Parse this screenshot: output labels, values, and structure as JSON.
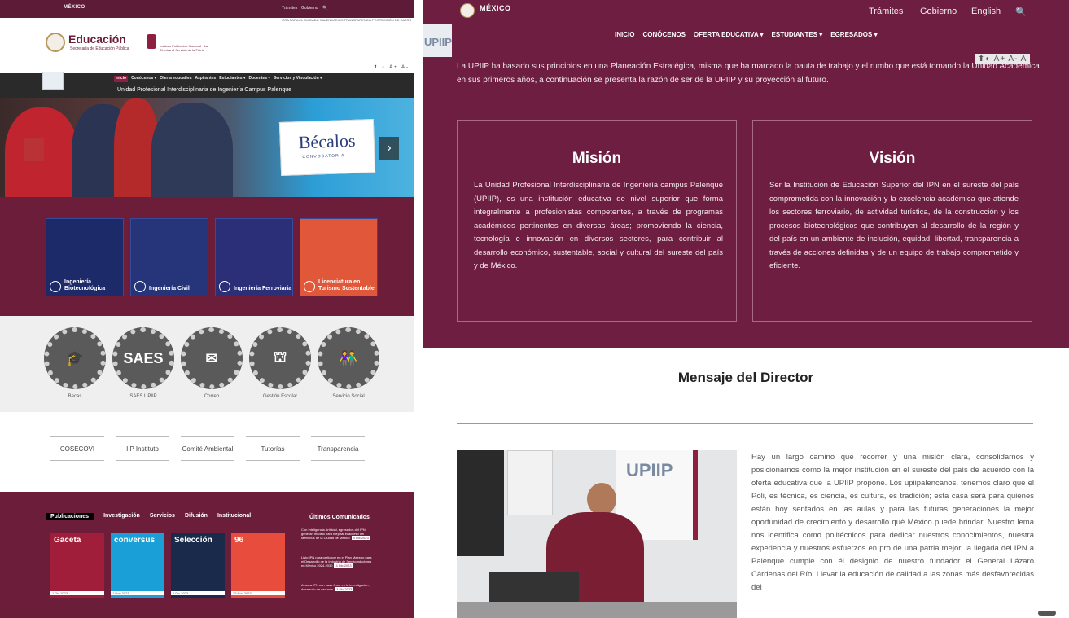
{
  "left": {
    "gov_logo": "MÉXICO",
    "gov_links": [
      "Trámites",
      "Gobierno",
      "🔍"
    ],
    "sub_links": "VIRA PARA EL CUIDADO  CALENDARIOS  TRANSPARENCIA  PROTECCIÓN DE DATOS",
    "edu_title": "Educación",
    "edu_sub": "Secretaría de Educación Pública",
    "ipn_text": "Instituto Politécnico Nacional · La Técnica al Servicio de la Patria",
    "access": "⬆ ◐ A+ A-",
    "nav": [
      "Inicio",
      "Conócenos ▾",
      "Oferta educativa",
      "Aspirantes",
      "Estudiantes ▾",
      "Docentes ▾",
      "Servicios y Vinculación ▾"
    ],
    "unit_name": "Unidad Profesional Interdisciplinaria de Ingeniería Campus Palenque",
    "becalos_title": "Bécalos",
    "becalos_sub": "CONVOCATORIA",
    "carousel_next": "›",
    "cards": [
      {
        "label": "Ingeniería Biotecnológica",
        "color": "#1c2a6a"
      },
      {
        "label": "Ingeniería Civil",
        "color": "#26357a"
      },
      {
        "label": "Ingeniería Ferroviaria",
        "color": "#2a2f78"
      },
      {
        "label": "Licenciatura en Turismo Sustentable",
        "color": "#e0573a"
      }
    ],
    "services": [
      {
        "glyph": "🎓",
        "label": "Becas"
      },
      {
        "glyph": "SAES",
        "label": "SAES UPIIP"
      },
      {
        "glyph": "✉",
        "label": "Correo"
      },
      {
        "glyph": "⛫",
        "label": "Gestión Escolar"
      },
      {
        "glyph": "👫",
        "label": "Servicio Social"
      }
    ],
    "logos": [
      "COSECOVI",
      "IIP Instituto",
      "Comité Ambiental",
      "Tutorías",
      "Transparencia"
    ],
    "tabs": [
      "Publicaciones",
      "Investigación",
      "Servicios",
      "Difusión",
      "Institucional"
    ],
    "comunicados_title": "Últimos Comunicados",
    "pubs": [
      {
        "title": "Gaceta",
        "date": "1 Dic 2023",
        "color": "#a01e3a"
      },
      {
        "title": "conversus",
        "date": "1 Nov 2023",
        "color": "#1a9fd6"
      },
      {
        "title": "Selección",
        "date": "1 Dic 2023",
        "color": "#1a2a4a"
      },
      {
        "title": "96",
        "date": "25 Nov 2023",
        "color": "#e74c3c"
      }
    ],
    "news": [
      {
        "text": "Con Inteligencia Artificial, egresados del IPN generan modelo para mejorar el acceso del Metrobús de la Ciudad de México",
        "date": "4 Dic 2023"
      },
      {
        "text": "Listo IPN para participar en el Plan Maestro para el Desarrollo de la Industria de Semiconductores en México 2024-2030",
        "date": "4 Dic 2023"
      },
      {
        "text": "Avanza IPN con paso firme en la investigación y desarrollo de vacunas",
        "date": "3 Dic 2023"
      }
    ]
  },
  "right": {
    "gov_logo": "MÉXICO",
    "gov_links": [
      "Trámites",
      "Gobierno",
      "English",
      "🔍"
    ],
    "nav": [
      "INICIO",
      "CONÓCENOS",
      "OFERTA EDUCATIVA ▾",
      "ESTUDIANTES ▾",
      "EGRESADOS ▾"
    ],
    "upiip_badge": "UPIIP",
    "access": "⬆◐ A+ A- A",
    "intro": "La UPIIP ha basado sus principios en una Planeación Estratégica, misma que ha marcado la pauta de trabajo y el rumbo que está tomando la Unidad Académica en sus primeros años, a continuación se presenta la razón de ser de la UPIIP y su proyección al futuro.",
    "mision_title": "Misión",
    "mision_text": "La Unidad Profesional Interdisciplinaria de Ingeniería campus Palenque (UPIIP), es una institución educativa de nivel superior que forma integralmente a profesionistas competentes, a través de programas académicos pertinentes en diversas áreas; promoviendo la ciencia, tecnología e innovación en diversos sectores, para contribuir al desarrollo económico, sustentable, social y cultural del sureste del país y de México.",
    "vision_title": "Visión",
    "vision_text": "Ser la Institución de Educación Superior del IPN en el sureste del país comprometida con la innovación y la excelencia académica que atiende los sectores ferroviario, de actividad turística, de la construcción y los procesos biotecnológicos que contribuyen al desarrollo de la región y del país en un ambiente de inclusión, equidad, libertad, transparencia a través de acciones definidas y de un equipo de trabajo comprometido y eficiente.",
    "director_title": "Mensaje del Director",
    "director_text": "Hay un largo camino que recorrer y una misión clara, consolidarnos y posicionarnos como la mejor institución en el sureste del país de acuerdo con la oferta educativa que la UPIIP propone. Los upiipalencanos, tenemos claro que el Poli, es técnica, es ciencia, es cultura, es tradición; esta casa será para quienes están hoy sentados en las aulas y para las futuras generaciones la mejor oportunidad de crecimiento y desarrollo qué México puede brindar. Nuestro lema nos identifica como politécnicos para dedicar nuestros conocimientos, nuestra experiencia y nuestros esfuerzos en pro de una patria mejor, la llegada del IPN a Palenque cumple con él designio de nuestro fundador el General Lázaro Cárdenas del Río: Llevar la educación de calidad a las zonas más desfavorecidas del",
    "photo_banner": "UPIIP"
  }
}
